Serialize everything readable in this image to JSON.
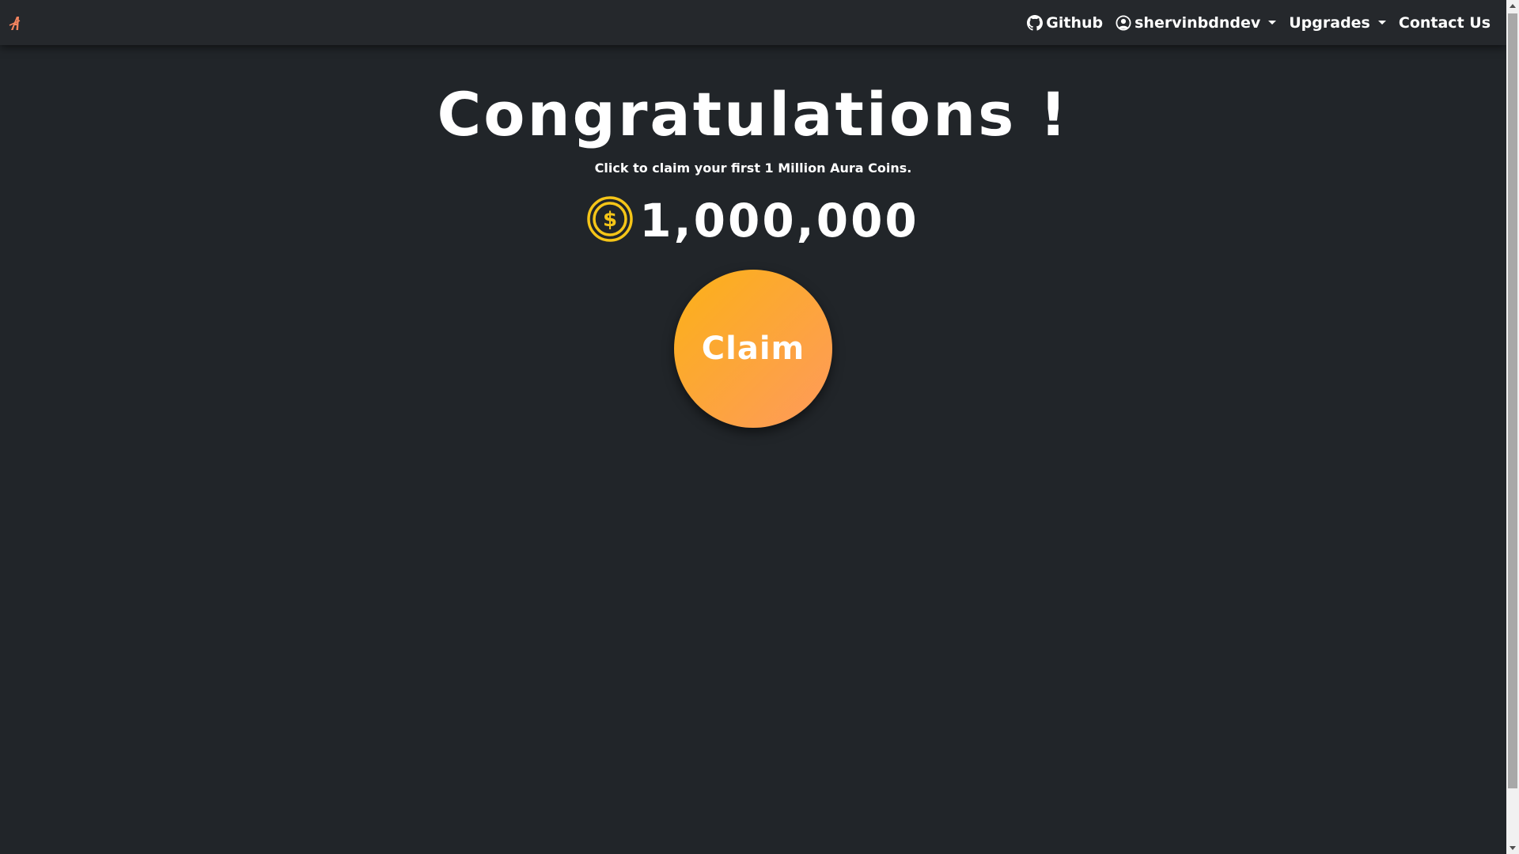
{
  "navbar": {
    "brand_icon": "aura-logo-icon",
    "brand_color": "#f4845f",
    "github_label": "Github",
    "github_icon": "github-icon",
    "user_label": "shervinbdndev",
    "user_icon": "user-circle-icon",
    "upgrades_label": "Upgrades",
    "contact_label": "Contact Us"
  },
  "main": {
    "title": "Congratulations !",
    "subtitle": "Click to claim your first 1 Million Aura Coins.",
    "coin_icon": "dollar-coin-icon",
    "coin_color": "#f5c518",
    "amount": "1,000,000",
    "claim_label": "Claim",
    "claim_gradient": [
      "#fbb117",
      "#fe9a5c"
    ]
  },
  "theme": {
    "background": "#212529",
    "navbar_background": "#25282c",
    "text": "#ffffff"
  }
}
